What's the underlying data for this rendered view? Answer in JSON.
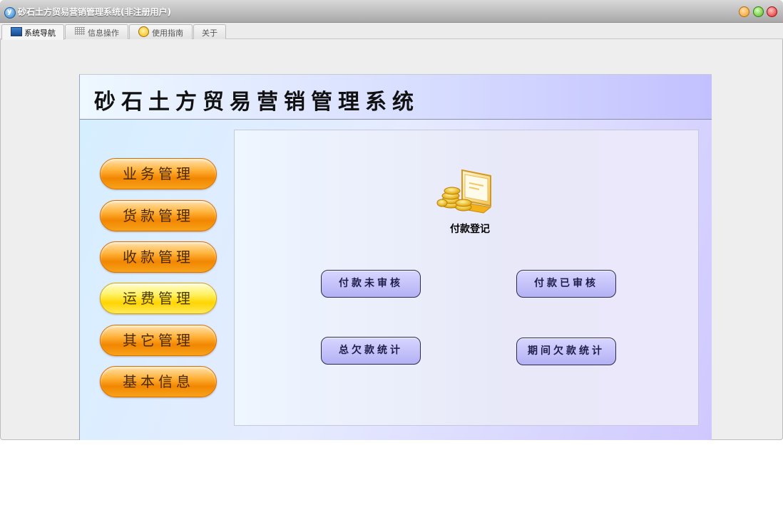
{
  "window": {
    "title": "砂石土方贸易营销管理系统(非注册用户)"
  },
  "tabs": [
    {
      "label": "系统导航",
      "icon": "monitor-icon",
      "active": true
    },
    {
      "label": "信息操作",
      "icon": "grid-icon",
      "active": false
    },
    {
      "label": "使用指南",
      "icon": "coin-icon",
      "active": false
    },
    {
      "label": "关于",
      "icon": "",
      "active": false
    }
  ],
  "main": {
    "system_title": "砂石土方贸易营销管理系统",
    "sidebar": [
      {
        "label": "业务管理",
        "selected": false
      },
      {
        "label": "货款管理",
        "selected": false
      },
      {
        "label": "收款管理",
        "selected": false
      },
      {
        "label": "运费管理",
        "selected": true
      },
      {
        "label": "其它管理",
        "selected": false
      },
      {
        "label": "基本信息",
        "selected": false
      }
    ],
    "content": {
      "feature_label": "付款登记",
      "feature_icon": "payment-coins-icon",
      "buttons": [
        "付款未审核",
        "付款已审核",
        "总欠款统计",
        "期间欠款统计"
      ]
    }
  },
  "colors": {
    "sidebar_button": "#f28600",
    "sidebar_button_selected": "#ffd400",
    "action_button": "#b4b1f5"
  }
}
